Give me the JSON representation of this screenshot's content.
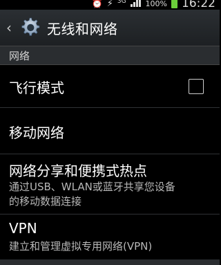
{
  "status_bar": {
    "network": "3G",
    "battery_percent": "100%",
    "time": "16:22",
    "icons": [
      "alarm-icon",
      "usb-icon",
      "network-activity-icon",
      "signal-icon",
      "battery-icon"
    ]
  },
  "action_bar": {
    "title": "无线和网络",
    "back_icon": "back-icon",
    "app_icon": "settings-gear-icon"
  },
  "section": {
    "label": "网络"
  },
  "items": [
    {
      "title": "飞行模式",
      "checked": false
    },
    {
      "title": "移动网络"
    },
    {
      "title": "网络分享和便携式热点",
      "summary_line1": "通过USB、WLAN或蓝牙共享您设备",
      "summary_line2": "的移动数据连接"
    },
    {
      "title": "VPN",
      "summary": "建立和管理虚拟专用网络(VPN)"
    }
  ],
  "colors": {
    "background": "#000000",
    "action_bar": "#2b2f33",
    "section_header": "#2a2d30",
    "battery": "#6bcf3b"
  }
}
